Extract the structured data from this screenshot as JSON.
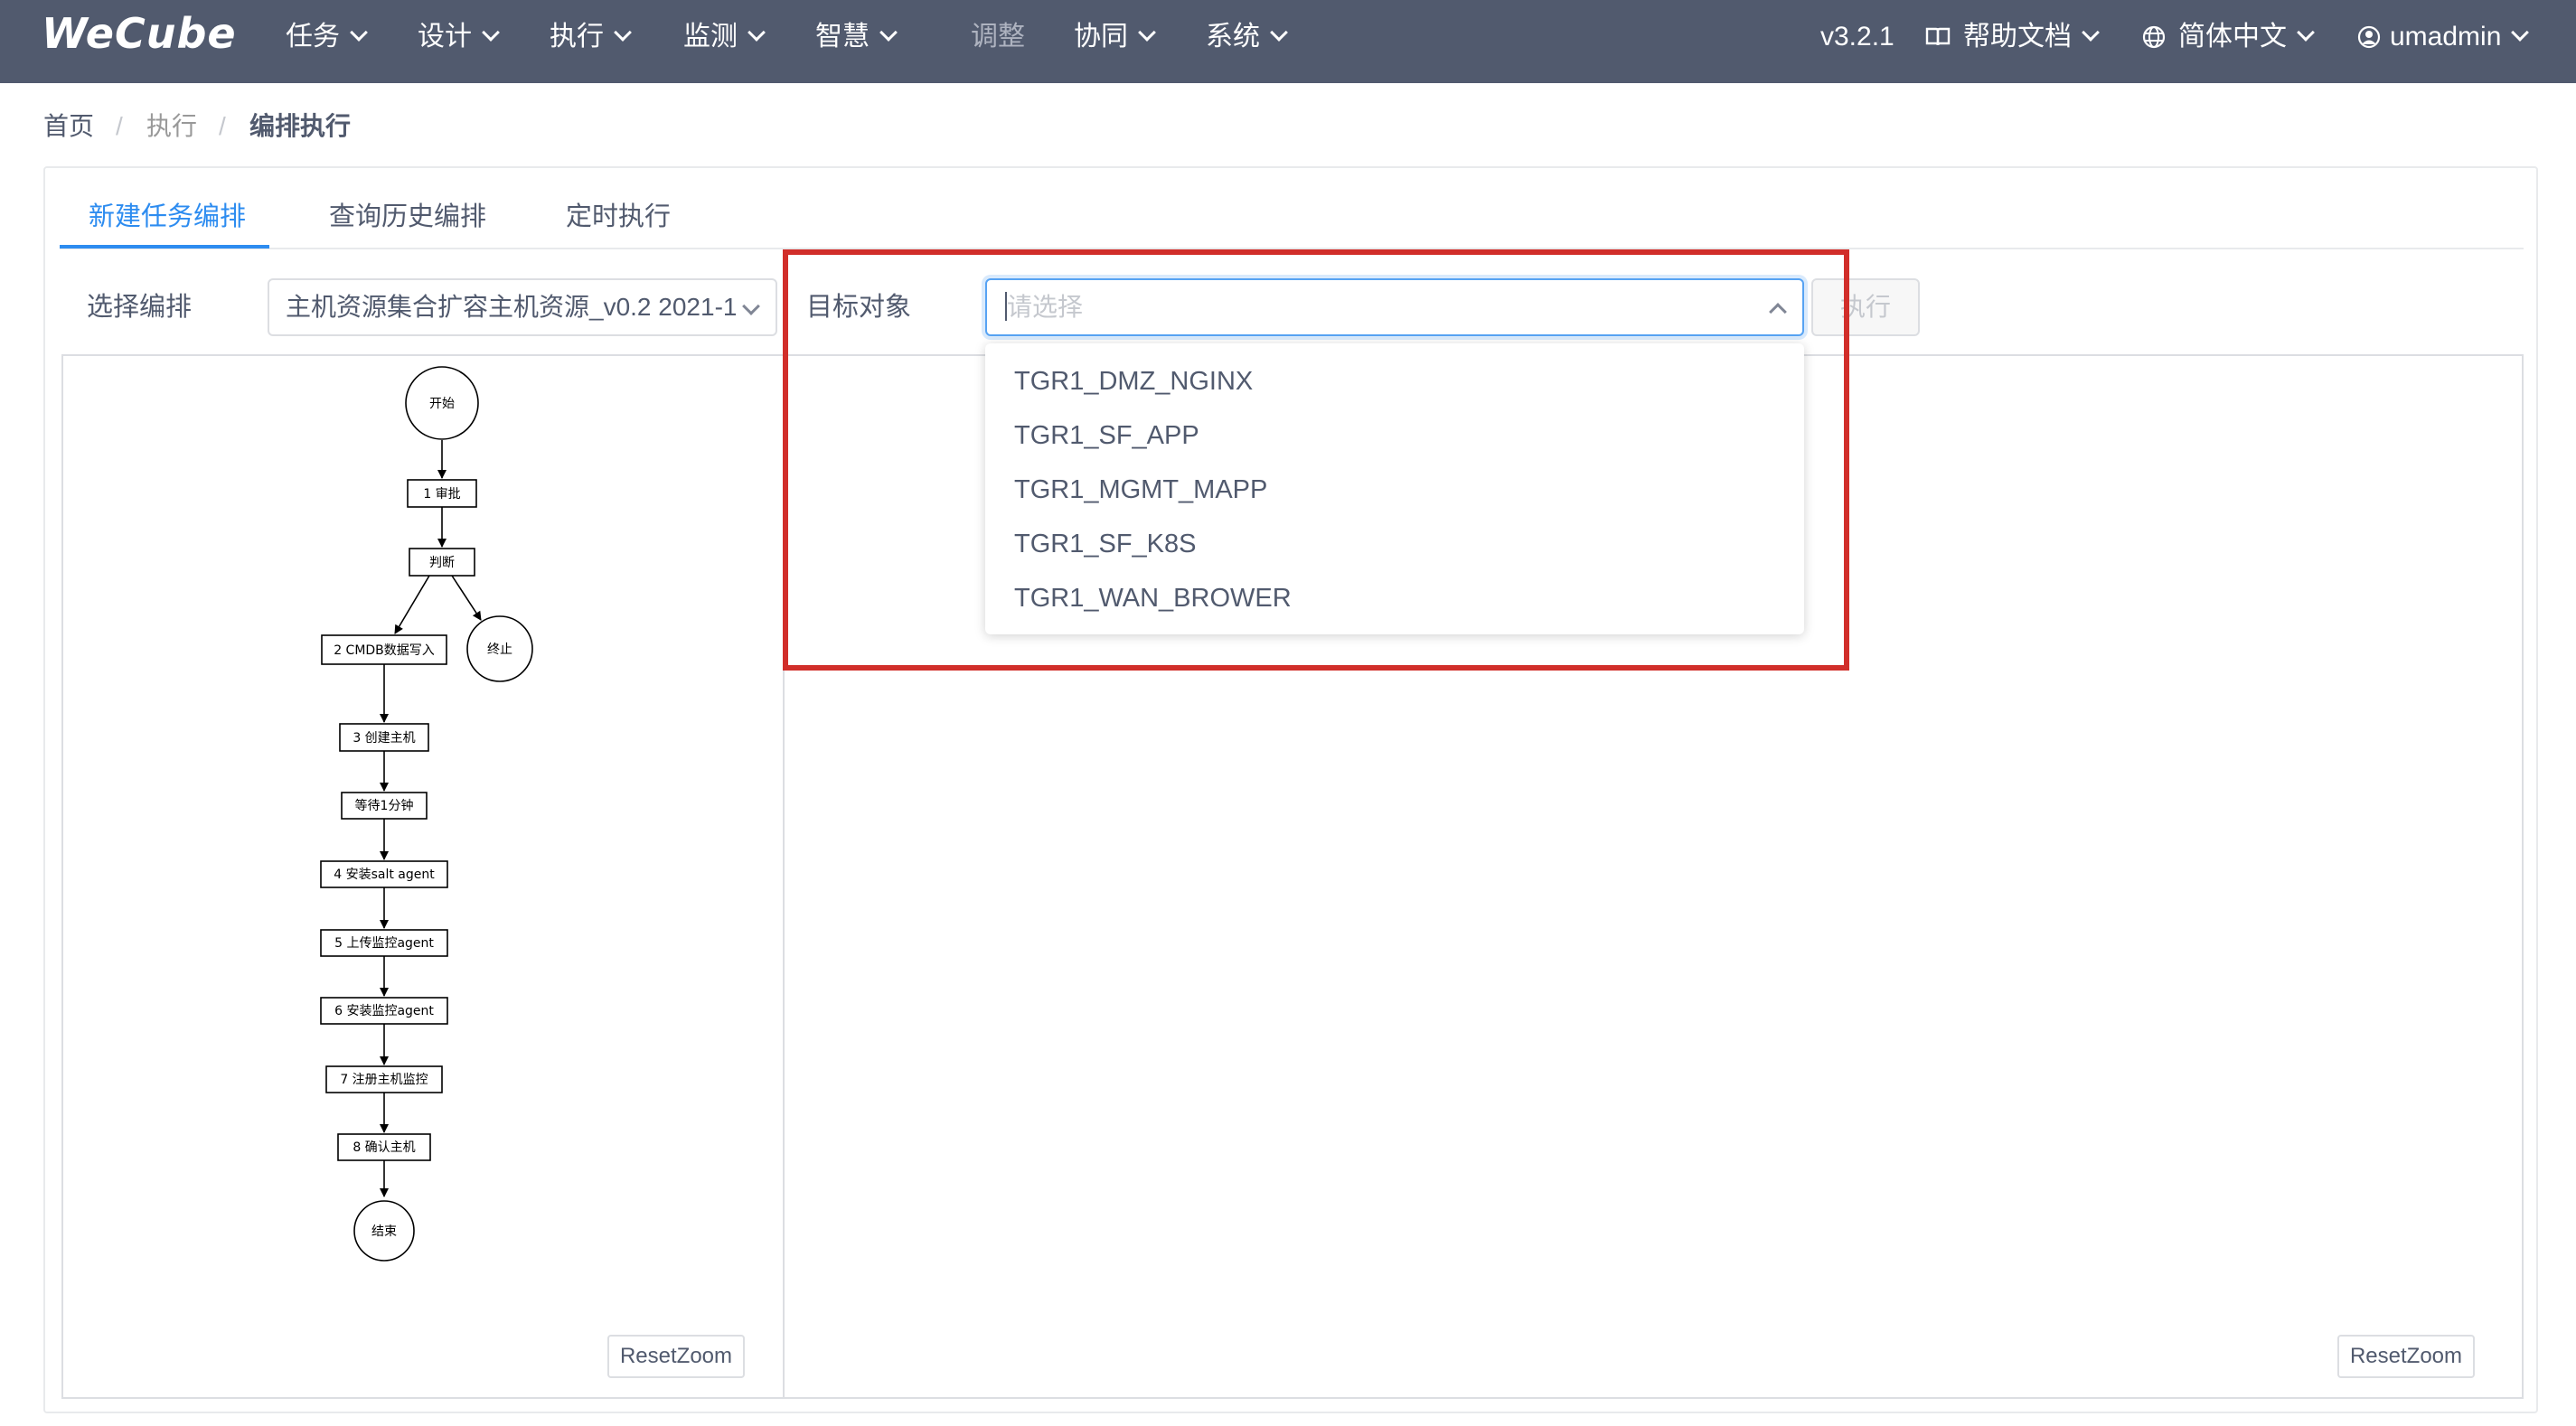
{
  "nav": {
    "logo": "WeCube",
    "menus": [
      {
        "label": "任务",
        "has_dropdown": true
      },
      {
        "label": "设计",
        "has_dropdown": true
      },
      {
        "label": "执行",
        "has_dropdown": true
      },
      {
        "label": "监测",
        "has_dropdown": true
      },
      {
        "label": "智慧",
        "has_dropdown": true
      },
      {
        "label": "调整",
        "has_dropdown": false
      },
      {
        "label": "协同",
        "has_dropdown": true
      },
      {
        "label": "系统",
        "has_dropdown": true
      }
    ],
    "version": "v3.2.1",
    "help_docs": "帮助文档",
    "language": "简体中文",
    "user": "umadmin",
    "icons": {
      "help": "book-icon",
      "language": "globe-icon",
      "user": "user-icon"
    }
  },
  "breadcrumb": {
    "items": [
      "首页",
      "执行",
      "编排执行"
    ],
    "separator": "/"
  },
  "tabs": [
    {
      "label": "新建任务编排",
      "active": true
    },
    {
      "label": "查询历史编排",
      "active": false
    },
    {
      "label": "定时执行",
      "active": false
    }
  ],
  "form": {
    "orchestration_label": "选择编排",
    "orchestration_value": "主机资源集合扩容主机资源_v0.2 2021-1",
    "target_label": "目标对象",
    "target_placeholder": "请选择",
    "execute_button": "执行"
  },
  "dropdown": {
    "options": [
      "TGR1_DMZ_NGINX",
      "TGR1_SF_APP",
      "TGR1_MGMT_MAPP",
      "TGR1_SF_K8S",
      "TGR1_WAN_BROWER"
    ]
  },
  "flowchart": {
    "nodes": {
      "start": "开始",
      "n1": "1 审批",
      "judge": "判断",
      "stop": "终止",
      "n2": "2 CMDB数据写入",
      "n3": "3 创建主机",
      "wait": "等待1分钟",
      "n4": "4 安装salt agent",
      "n5": "5 上传监控agent",
      "n6": "6 安装监控agent",
      "n7": "7 注册主机监控",
      "n8": "8 确认主机",
      "end": "结束"
    }
  },
  "reset_zoom": "ResetZoom",
  "colors": {
    "nav_bg": "#515a6e",
    "accent": "#2d8cf0",
    "highlight": "#d12e2a"
  }
}
